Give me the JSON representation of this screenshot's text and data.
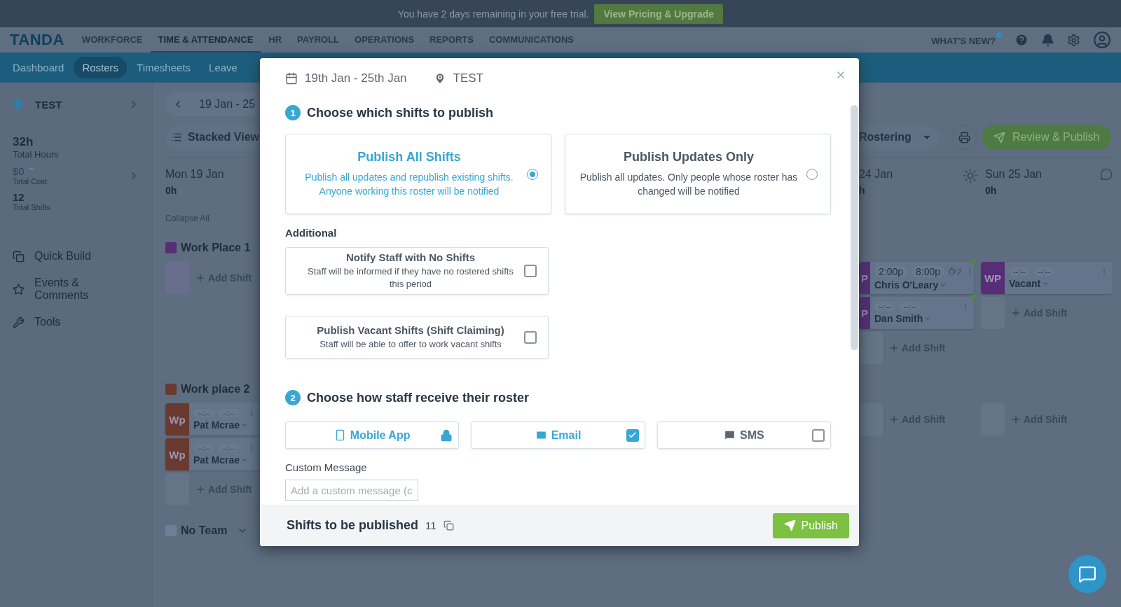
{
  "banner": {
    "text": "You have 2 days remaining in your free trial.",
    "button": "View Pricing & Upgrade"
  },
  "nav": {
    "logo": "TANDA",
    "whats_new": "WHAT'S NEW?",
    "items": [
      {
        "label": "WORKFORCE",
        "selected": false
      },
      {
        "label": "TIME & ATTENDANCE",
        "selected": true
      },
      {
        "label": "HR",
        "selected": false
      },
      {
        "label": "PAYROLL",
        "selected": false
      },
      {
        "label": "OPERATIONS",
        "selected": false
      },
      {
        "label": "REPORTS",
        "selected": false
      },
      {
        "label": "COMMUNICATIONS",
        "selected": false
      }
    ]
  },
  "subnav": [
    {
      "label": "Dashboard",
      "selected": false
    },
    {
      "label": "Rosters",
      "selected": true
    },
    {
      "label": "Timesheets",
      "selected": false
    },
    {
      "label": "Leave",
      "selected": false
    }
  ],
  "sidebar": {
    "location": "TEST",
    "stats": [
      {
        "kind": "hours",
        "value": "32h",
        "label": "Total Hours"
      },
      {
        "kind": "cost",
        "value": "$0",
        "label": "Total Cost"
      },
      {
        "kind": "count",
        "value": "12",
        "label": "Total Shifts"
      }
    ],
    "tools": [
      {
        "kind": "quick-build",
        "label": "Quick Build"
      },
      {
        "kind": "events",
        "label": "Events & Comments"
      },
      {
        "kind": "tools",
        "label": "Tools"
      }
    ]
  },
  "roster": {
    "date_range": "19 Jan - 25",
    "view": "Stacked View",
    "mode": "Rostering",
    "review_button": "Review & Publish",
    "collapse": "Collapse All",
    "days": [
      {
        "name": "Mon 19 Jan",
        "hours": "0h"
      },
      {
        "name": "24 Jan",
        "hours": "h"
      },
      {
        "name": "Sun 25 Jan",
        "hours": "0h"
      }
    ],
    "teams": [
      {
        "name": "Work Place 1",
        "color": "#572d78",
        "days": [
          [
            {
              "kind": "add",
              "label": "Add Shift"
            }
          ],
          [
            {
              "kind": "shift",
              "avatar": "P",
              "start": "2:00p",
              "end": "8:00p",
              "scheduled": true,
              "name": "Chris O'Leary",
              "breaks": "2",
              "status_dot": true
            },
            {
              "kind": "shift",
              "avatar": "P",
              "start": "--:--",
              "end": "--:--",
              "scheduled": false,
              "name": "Dan Smith",
              "status_dot": true
            },
            {
              "kind": "add",
              "label": "Add Shift"
            }
          ],
          [
            {
              "kind": "shift",
              "avatar": "WP",
              "start": "--:--",
              "end": "--:--",
              "scheduled": false,
              "name": "Vacant",
              "status_dot": false
            },
            {
              "kind": "add",
              "label": "Add Shift"
            }
          ]
        ]
      },
      {
        "name": "Work place 2",
        "color": "#6a3a30",
        "days": [
          [
            {
              "kind": "shift",
              "avatar": "Wp",
              "start": "--:--",
              "end": "--:--",
              "scheduled": false,
              "name": "Pat Mcrae",
              "status_dot": false
            },
            {
              "kind": "shift",
              "avatar": "Wp",
              "start": "--:--",
              "end": "--:--",
              "scheduled": false,
              "name": "Pat Mcrae",
              "status_dot": false
            },
            {
              "kind": "add",
              "label": "Add Shift"
            }
          ],
          [
            {
              "kind": "add",
              "label": "Add Shift"
            }
          ],
          [
            {
              "kind": "add",
              "label": "Add Shift"
            }
          ]
        ]
      },
      {
        "name": "No Team",
        "color": "#6e7f9a"
      }
    ]
  },
  "dialog": {
    "date_range": "19th Jan - 25th Jan",
    "location": "TEST",
    "step1": {
      "number": "1",
      "title": "Choose which shifts to publish",
      "options": [
        {
          "title": "Publish All Shifts",
          "description": "Publish all updates and republish existing shifts. Anyone working this roster will be notified",
          "selected": true
        },
        {
          "title": "Publish Updates Only",
          "description": "Publish all updates. Only people whose roster has changed will be notified",
          "selected": false
        }
      ]
    },
    "additional": {
      "title": "Additional",
      "options": [
        {
          "title": "Notify Staff with No Shifts",
          "description": "Staff will be informed if they have no rostered shifts this period",
          "checked": false
        },
        {
          "title": "Publish Vacant Shifts (Shift Claiming)",
          "description": "Staff will be able to offer to work vacant shifts",
          "checked": false
        }
      ]
    },
    "step2": {
      "number": "2",
      "title": "Choose how staff receive their roster",
      "channels": [
        {
          "kind": "mobile",
          "label": "Mobile App",
          "checked": true,
          "locked": true
        },
        {
          "kind": "email",
          "label": "Email",
          "checked": true,
          "locked": false
        },
        {
          "kind": "sms",
          "label": "SMS",
          "checked": false,
          "locked": false
        }
      ]
    },
    "custom_message": {
      "label": "Custom Message",
      "placeholder": "Add a custom message (c"
    },
    "footer": {
      "label": "Shifts to be published",
      "count": "11",
      "button": "Publish"
    }
  }
}
